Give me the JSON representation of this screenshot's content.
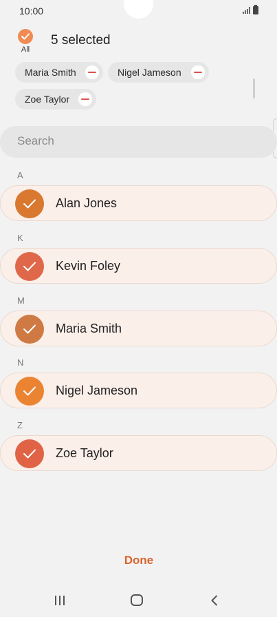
{
  "status_bar": {
    "time": "10:00"
  },
  "header": {
    "all_label": "All",
    "selected_count": "5 selected"
  },
  "chips": [
    {
      "label": "Maria Smith"
    },
    {
      "label": "Nigel Jameson"
    },
    {
      "label": "Zoe Taylor"
    }
  ],
  "search": {
    "placeholder": "Search",
    "value": ""
  },
  "sections": [
    {
      "letter": "A",
      "contact": {
        "name": "Alan Jones",
        "avatar_color": "#d9782f",
        "checked": true
      }
    },
    {
      "letter": "K",
      "contact": {
        "name": "Kevin Foley",
        "avatar_color": "#e0684a",
        "checked": true
      }
    },
    {
      "letter": "M",
      "contact": {
        "name": "Maria Smith",
        "avatar_color": "#cf7a44",
        "checked": true
      }
    },
    {
      "letter": "N",
      "contact": {
        "name": "Nigel Jameson",
        "avatar_color": "#ea8433",
        "checked": true
      }
    },
    {
      "letter": "Z",
      "contact": {
        "name": "Zoe Taylor",
        "avatar_color": "#e06346",
        "checked": true
      }
    }
  ],
  "footer": {
    "done_label": "Done"
  },
  "colors": {
    "accent": "#d8642c",
    "row_background": "#fbefe9",
    "check_orange": "#ef8b53"
  },
  "icons": {
    "recents": "recent-apps-icon",
    "home": "home-icon",
    "back": "back-icon"
  }
}
